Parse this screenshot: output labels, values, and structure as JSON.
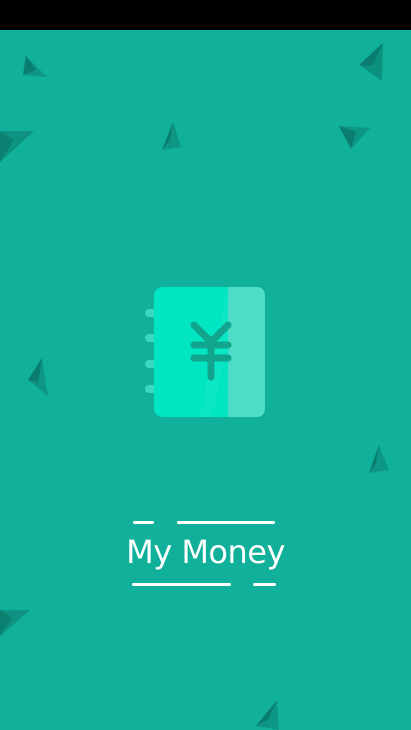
{
  "status_bar": {},
  "splash": {
    "background_color": "#10b09a",
    "app_name": "My Money",
    "logo": {
      "icon": "yen-notebook-icon",
      "symbol": "¥",
      "colors": {
        "cover": "#00e6c3",
        "spine": "#4fdcc6",
        "symbol": "#10a58c",
        "rings": "#3ad8c0"
      }
    },
    "decor_shard_color": "#0a8c7a"
  }
}
